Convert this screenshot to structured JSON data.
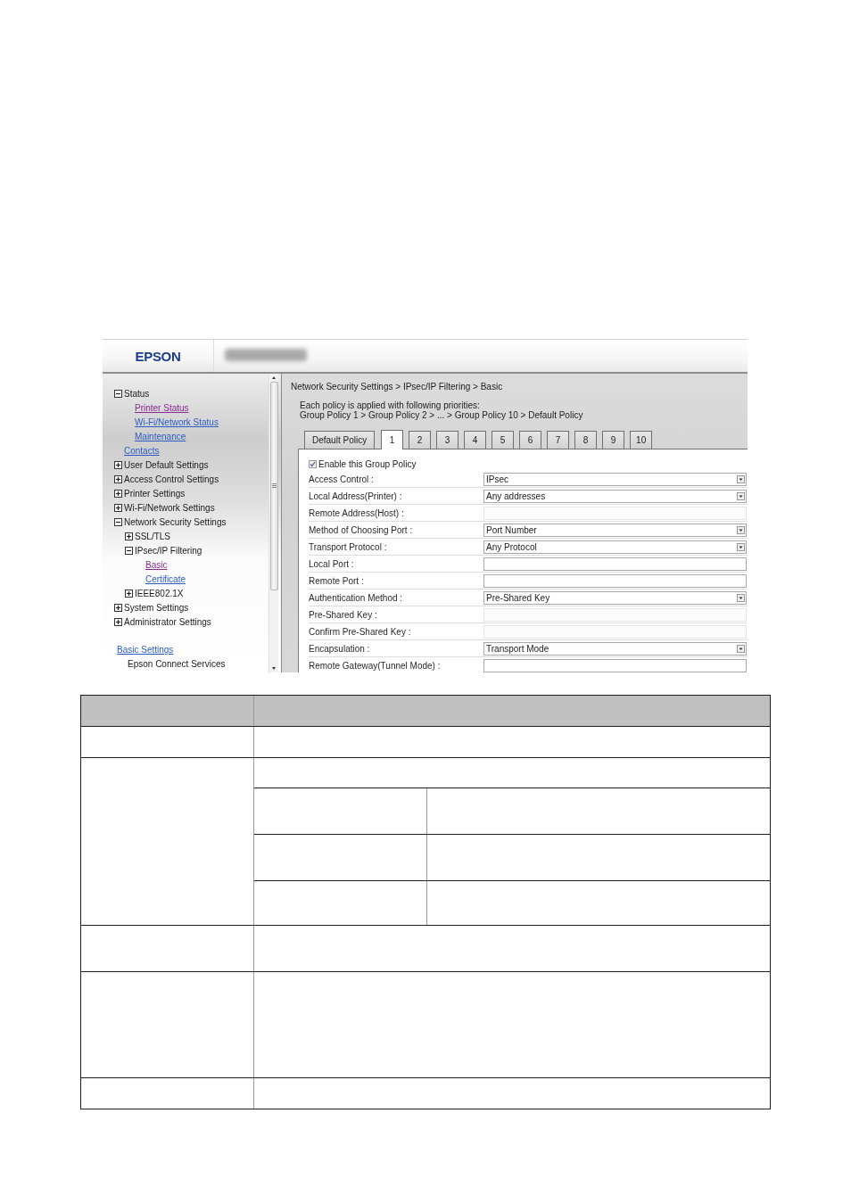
{
  "header": {
    "logo": "EPSON"
  },
  "sidebar": {
    "items": [
      {
        "kind": "folder",
        "label": "Status",
        "expanded": true,
        "children": [
          {
            "kind": "link",
            "label": "Printer Status",
            "visited": true
          },
          {
            "kind": "link",
            "label": "Wi-Fi/Network Status",
            "visited": false
          },
          {
            "kind": "link",
            "label": "Maintenance",
            "visited": false
          }
        ]
      },
      {
        "kind": "link",
        "label": "Contacts",
        "visited": false
      },
      {
        "kind": "folder",
        "label": "User Default Settings",
        "expanded": false
      },
      {
        "kind": "folder",
        "label": "Access Control Settings",
        "expanded": false
      },
      {
        "kind": "folder",
        "label": "Printer Settings",
        "expanded": false
      },
      {
        "kind": "folder",
        "label": "Wi-Fi/Network Settings",
        "expanded": false
      },
      {
        "kind": "folder",
        "label": "Network Security Settings",
        "expanded": true,
        "children": [
          {
            "kind": "folder",
            "label": "SSL/TLS",
            "expanded": false
          },
          {
            "kind": "folder",
            "label": "IPsec/IP Filtering",
            "expanded": true,
            "children": [
              {
                "kind": "link",
                "label": "Basic",
                "visited": true
              },
              {
                "kind": "link",
                "label": "Certificate",
                "visited": false
              }
            ]
          },
          {
            "kind": "folder",
            "label": "IEEE802.1X",
            "expanded": false
          }
        ]
      },
      {
        "kind": "folder",
        "label": "System Settings",
        "expanded": false
      },
      {
        "kind": "folder",
        "label": "Administrator Settings",
        "expanded": false
      }
    ],
    "extra_items": [
      {
        "kind": "link",
        "label": "Basic Settings",
        "visited": false,
        "children": [
          {
            "kind": "text",
            "label": "Epson Connect Services"
          }
        ]
      }
    ]
  },
  "main": {
    "breadcrumb": "Network Security Settings > IPsec/IP Filtering > Basic",
    "intro": [
      "Each policy is applied with following priorities:",
      "Group Policy 1 > Group Policy 2 > ... > Group Policy 10 > Default Policy"
    ],
    "tabs": [
      {
        "label": "Default Policy",
        "selected": false
      },
      {
        "label": "1",
        "selected": true
      },
      {
        "label": "2",
        "selected": false
      },
      {
        "label": "3",
        "selected": false
      },
      {
        "label": "4",
        "selected": false
      },
      {
        "label": "5",
        "selected": false
      },
      {
        "label": "6",
        "selected": false
      },
      {
        "label": "7",
        "selected": false
      },
      {
        "label": "8",
        "selected": false
      },
      {
        "label": "9",
        "selected": false
      },
      {
        "label": "10",
        "selected": false
      }
    ],
    "enable": {
      "label": "Enable this Group Policy",
      "checked": true
    },
    "fields": [
      {
        "kind": "select",
        "label": "Access Control :",
        "value": "IPsec",
        "disabled": false
      },
      {
        "kind": "select",
        "label": "Local Address(Printer) :",
        "value": "Any addresses",
        "disabled": false
      },
      {
        "kind": "text",
        "label": "Remote Address(Host) :",
        "disabled": true
      },
      {
        "kind": "select",
        "label": "Method of Choosing Port :",
        "value": "Port Number",
        "disabled": false
      },
      {
        "kind": "select",
        "label": "Transport Protocol :",
        "value": "Any Protocol",
        "disabled": false
      },
      {
        "kind": "text",
        "label": "Local Port :",
        "disabled": false
      },
      {
        "kind": "text",
        "label": "Remote Port :",
        "disabled": false
      },
      {
        "kind": "select",
        "label": "Authentication Method :",
        "value": "Pre-Shared Key",
        "disabled": false
      },
      {
        "kind": "text",
        "label": "Pre-Shared Key :",
        "disabled": true
      },
      {
        "kind": "text",
        "label": "Confirm Pre-Shared Key :",
        "disabled": true
      },
      {
        "kind": "select",
        "label": "Encapsulation :",
        "value": "Transport Mode",
        "disabled": false
      },
      {
        "kind": "text",
        "label": "Remote Gateway(Tunnel Mode) :",
        "disabled": false
      }
    ]
  },
  "table": {
    "rows": [
      {
        "kind": "header"
      },
      {
        "kind": "row"
      },
      {
        "kind": "group",
        "sub_rows": [
          {
            "kind": "span"
          },
          {
            "kind": "pair"
          },
          {
            "kind": "pair"
          },
          {
            "kind": "pair"
          }
        ]
      },
      {
        "kind": "row"
      },
      {
        "kind": "row"
      },
      {
        "kind": "row"
      }
    ]
  }
}
